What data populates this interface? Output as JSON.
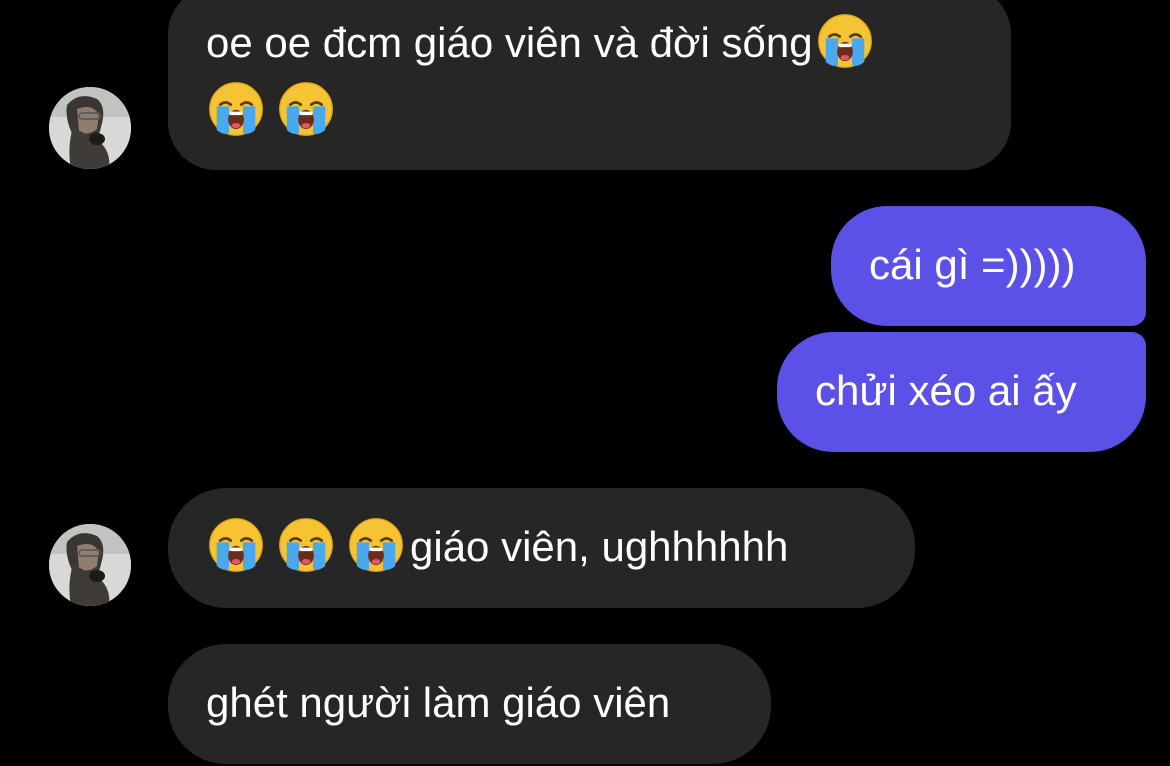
{
  "messages": {
    "m1": {
      "text": "oe oe đcm giáo viên và đời sống",
      "emoji_icon": "loudly-crying-face-icon"
    },
    "m2": {
      "text": "cái gì =)))))"
    },
    "m3": {
      "text": "chửi xéo ai ấy"
    },
    "m4": {
      "text": "giáo viên, ughhhhhh",
      "emoji_icon": "loudly-crying-face-icon"
    },
    "m5": {
      "text": "ghét người làm giáo viên"
    }
  },
  "colors": {
    "background": "#000000",
    "incoming_bubble": "#262626",
    "outgoing_bubble": "#5b51e6",
    "text": "#ffffff"
  }
}
